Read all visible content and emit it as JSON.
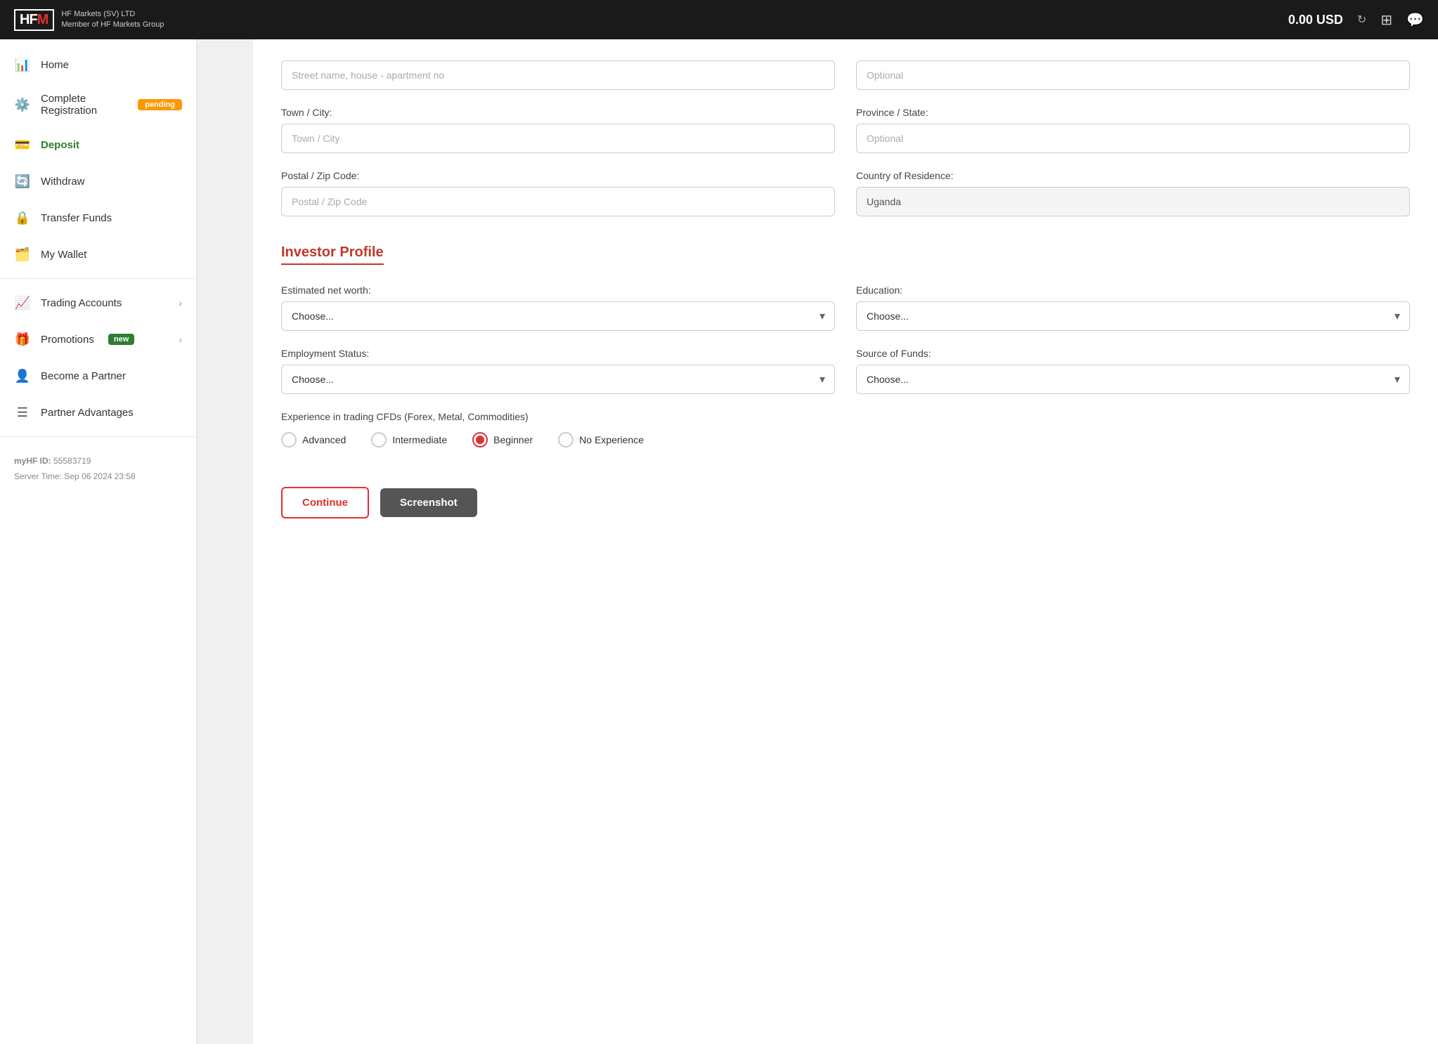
{
  "header": {
    "logo_hf": "HF",
    "logo_m": "M",
    "company_name": "HF Markets (SV) LTD",
    "company_sub": "Member of HF Markets Group",
    "balance": "0.00 USD"
  },
  "sidebar": {
    "items": [
      {
        "id": "home",
        "label": "Home",
        "icon": "📊",
        "active": false,
        "badge": null,
        "chevron": false
      },
      {
        "id": "complete-registration",
        "label": "Complete Registration",
        "icon": "⚙️",
        "active": false,
        "badge": "pending",
        "chevron": false
      },
      {
        "id": "deposit",
        "label": "Deposit",
        "icon": "💳",
        "active": true,
        "badge": null,
        "chevron": false
      },
      {
        "id": "withdraw",
        "label": "Withdraw",
        "icon": "🔄",
        "active": false,
        "badge": null,
        "chevron": false
      },
      {
        "id": "transfer-funds",
        "label": "Transfer Funds",
        "icon": "🔒",
        "active": false,
        "badge": null,
        "chevron": false
      },
      {
        "id": "my-wallet",
        "label": "My Wallet",
        "icon": "🗂️",
        "active": false,
        "badge": null,
        "chevron": false
      },
      {
        "id": "trading-accounts",
        "label": "Trading Accounts",
        "icon": "📈",
        "active": false,
        "badge": null,
        "chevron": true
      },
      {
        "id": "promotions",
        "label": "Promotions",
        "icon": "🎁",
        "active": false,
        "badge": "new",
        "chevron": true
      },
      {
        "id": "become-partner",
        "label": "Become a Partner",
        "icon": "👤",
        "active": false,
        "badge": null,
        "chevron": false
      },
      {
        "id": "partner-advantages",
        "label": "Partner Advantages",
        "icon": "☰",
        "active": false,
        "badge": null,
        "chevron": false
      }
    ],
    "footer": {
      "id_label": "myHF ID:",
      "id_value": "55583719",
      "server_time_label": "Server Time:",
      "server_time_value": "Sep 06 2024 23:58"
    }
  },
  "form": {
    "street_label": "Street name, house - apartment no",
    "street_placeholder": "Street name, house - apartment no",
    "optional_placeholder": "Optional",
    "town_label": "Town / City:",
    "town_placeholder": "Town / City",
    "province_label": "Province / State:",
    "province_placeholder": "Optional",
    "postal_label": "Postal / Zip Code:",
    "postal_placeholder": "Postal / Zip Code",
    "country_label": "Country of Residence:",
    "country_value": "Uganda",
    "investor_profile_heading": "Investor Profile",
    "net_worth_label": "Estimated net worth:",
    "net_worth_placeholder": "Choose...",
    "education_label": "Education:",
    "education_placeholder": "Choose...",
    "employment_label": "Employment Status:",
    "employment_placeholder": "Choose...",
    "funds_label": "Source of Funds:",
    "funds_placeholder": "Choose...",
    "experience_label": "Experience in trading CFDs (Forex, Metal, Commodities)",
    "experience_options": [
      {
        "id": "advanced",
        "label": "Advanced",
        "selected": false
      },
      {
        "id": "intermediate",
        "label": "Intermediate",
        "selected": false
      },
      {
        "id": "beginner",
        "label": "Beginner",
        "selected": true
      },
      {
        "id": "no-experience",
        "label": "No Experience",
        "selected": false
      }
    ],
    "continue_btn": "Continue",
    "screenshot_btn": "Screenshot"
  }
}
